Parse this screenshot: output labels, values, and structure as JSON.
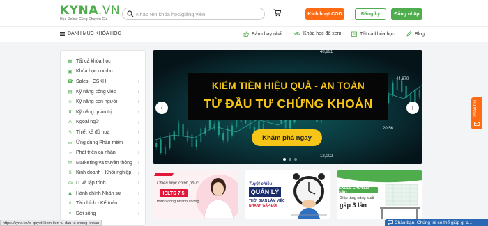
{
  "header": {
    "logo_main": "KYNA",
    "logo_suffix": ".VN",
    "logo_sub": "Học Online Cùng Chuyên Gia",
    "search_placeholder": "Nhập tên khóa học/giảng viên",
    "cod_button": "Kích hoạt COD",
    "register_button": "Đăng ký",
    "login_button": "Đăng nhập"
  },
  "nav": {
    "category_menu": "DANH MỤC KHÓA HỌC",
    "links": [
      "Bán chạy nhất",
      "Khóa học đã xem",
      "Tất cả khóa học",
      "Blog"
    ]
  },
  "sidebar": {
    "items": [
      {
        "label": "Tất cả khóa học",
        "icon": "grid-icon",
        "chevron": false
      },
      {
        "label": "Khóa học combo",
        "icon": "combo-icon",
        "chevron": false
      },
      {
        "label": "Sales - CSKH",
        "icon": "sales-icon",
        "chevron": true
      },
      {
        "label": "Kỹ năng công việc",
        "icon": "briefcase-icon",
        "chevron": true
      },
      {
        "label": "Kỹ năng con người",
        "icon": "people-icon",
        "chevron": true
      },
      {
        "label": "Kỹ năng quản trị",
        "icon": "management-icon",
        "chevron": true
      },
      {
        "label": "Ngoại ngữ",
        "icon": "language-icon",
        "chevron": true
      },
      {
        "label": "Thiết kế đồ hoạ",
        "icon": "design-icon",
        "chevron": true
      },
      {
        "label": "Ứng dụng Phần mềm",
        "icon": "software-icon",
        "chevron": true
      },
      {
        "label": "Phát triển cá nhân",
        "icon": "growth-icon",
        "chevron": true
      },
      {
        "label": "Marketing và truyền thông",
        "icon": "megaphone-icon",
        "chevron": true
      },
      {
        "label": "Kinh doanh - Khởi nghiệp",
        "icon": "business-icon",
        "chevron": true
      },
      {
        "label": "IT và lập trình",
        "icon": "code-icon",
        "chevron": true
      },
      {
        "label": "Hành chính Nhân sự",
        "icon": "hr-icon",
        "chevron": true
      },
      {
        "label": "Tài chính - Kế toán",
        "icon": "finance-icon",
        "chevron": true
      },
      {
        "label": "Đời sống",
        "icon": "life-icon",
        "chevron": true
      }
    ]
  },
  "banner": {
    "line1": "KIẾM TIỀN HIỆU QUẢ - AN TOÀN",
    "line2": "TỪ ĐẦU TƯ CHỨNG KHOÁN",
    "cta": "Khám phá ngay",
    "numbers": [
      "48,991",
      "44,870",
      "20,56",
      "12,002"
    ],
    "active_slide_index": 0,
    "slide_count": 3
  },
  "cards": [
    {
      "line1": "Chiến lược chinh phục",
      "badge": "IELTS 7.5",
      "line2": "thành công nhanh chóng"
    },
    {
      "line1": "Tuyệt chiêu",
      "title": "QUẢN LÝ",
      "line2": "THỜI GIAN LÀM VIỆC",
      "line3": "NHANH GẤP ĐÔI"
    },
    {
      "pill": "EXCEL CHUYÊN SÂU",
      "line1": "Giúp tăng năng suất",
      "line2": "gấp 3 lần"
    }
  ],
  "side_tab": "Phản hồi",
  "status_url": "https://kyna.vn/bi-quyet-kiem-tien-tu-dau-tu-chung-khoan",
  "chat": "Chào bạn, Chúng tôi có thể giúp gì c...",
  "colors": {
    "brand": "#50ad4e",
    "cod": "#ff6b12",
    "banner_text": "#f5c517",
    "chat": "#2a68b3"
  }
}
